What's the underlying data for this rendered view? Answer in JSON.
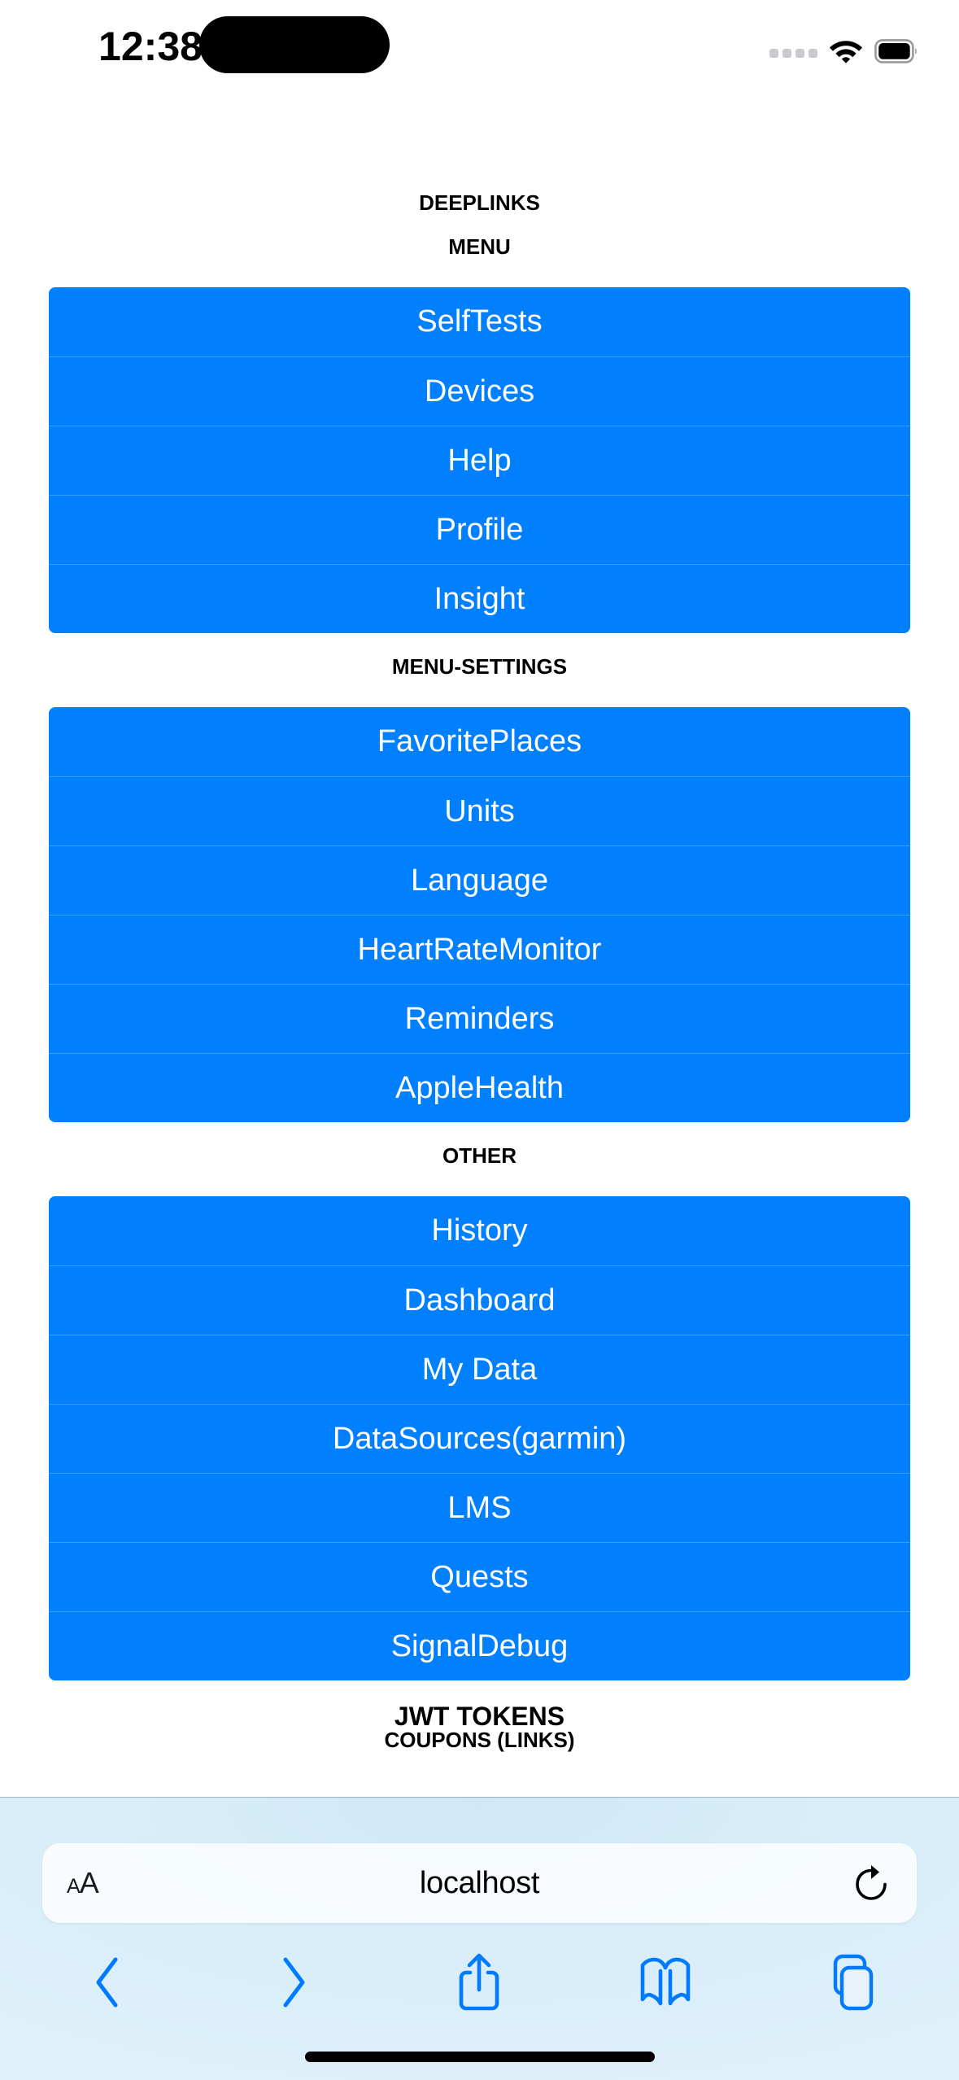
{
  "status_bar": {
    "time": "12:38",
    "icons": {
      "signal": "cellular-signal-dots",
      "wifi": "wifi-icon",
      "battery": "battery-full-icon"
    }
  },
  "page": {
    "title": "DEEPLINKS",
    "sections": [
      {
        "heading": "MENU",
        "level": "h3",
        "items": [
          "SelfTests",
          "Devices",
          "Help",
          "Profile",
          "Insight"
        ]
      },
      {
        "heading": "MENU-SETTINGS",
        "level": "h3",
        "items": [
          "FavoritePlaces",
          "Units",
          "Language",
          "HeartRateMonitor",
          "Reminders",
          "AppleHealth"
        ]
      },
      {
        "heading": "OTHER",
        "level": "h3",
        "items": [
          "History",
          "Dashboard",
          "My Data",
          "DataSources(garmin)",
          "LMS",
          "Quests",
          "SignalDebug"
        ]
      }
    ],
    "trailing_headings": [
      {
        "text": "JWT TOKENS",
        "level": "h2"
      },
      {
        "text": "COUPONS (LINKS)",
        "level": "h3"
      }
    ]
  },
  "browser": {
    "address_bar": {
      "url": "localhost",
      "text_size_label_small": "A",
      "text_size_label_large": "A",
      "reload_icon": "reload-icon"
    },
    "toolbar": [
      {
        "name": "back",
        "icon": "chevron-left-icon"
      },
      {
        "name": "forward",
        "icon": "chevron-right-icon"
      },
      {
        "name": "share",
        "icon": "share-icon"
      },
      {
        "name": "bookmarks",
        "icon": "book-icon"
      },
      {
        "name": "tabs",
        "icon": "tabs-icon"
      }
    ]
  },
  "colors": {
    "button_blue": "#0080ff",
    "toolbar_blue": "#007aff",
    "page_background": "#ffffff"
  }
}
